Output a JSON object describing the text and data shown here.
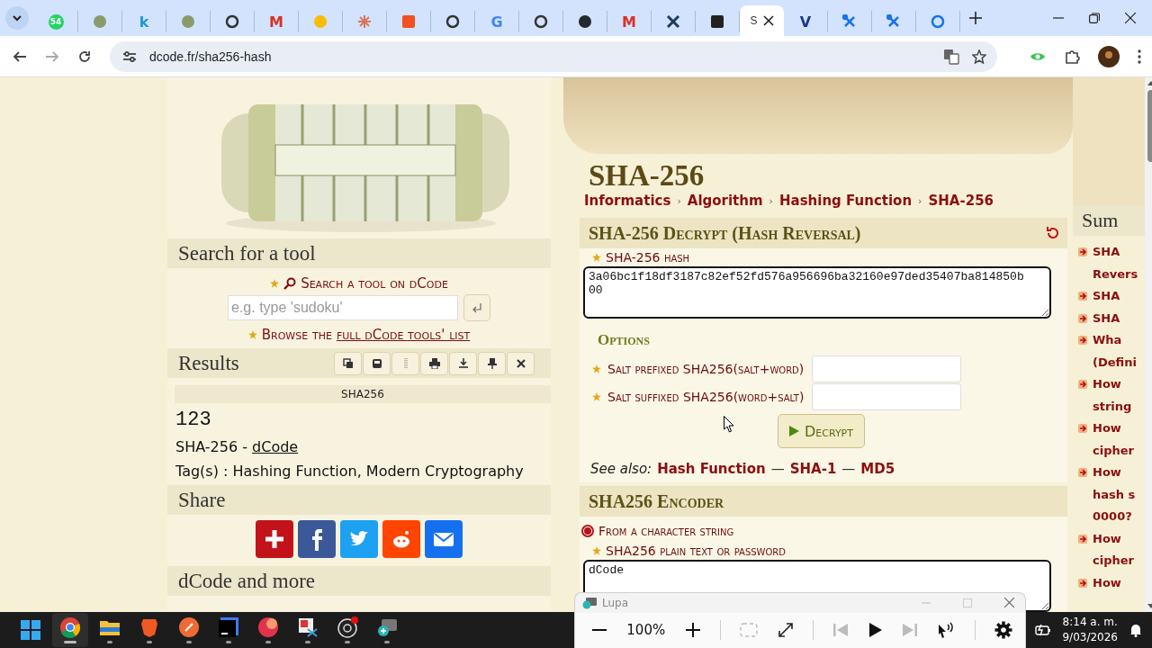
{
  "browser": {
    "tabs": [
      {
        "kind": "badge",
        "badge": "54",
        "color": "#25d366",
        "selected": false
      },
      {
        "kind": "dot",
        "color": "#8a9a6a",
        "selected": false
      },
      {
        "kind": "glyph",
        "glyph": "k",
        "color": "#1a9bd7",
        "selected": false
      },
      {
        "kind": "dot",
        "color": "#8a9a6b",
        "selected": false
      },
      {
        "kind": "ring",
        "color": "#333333",
        "selected": false
      },
      {
        "kind": "glyph",
        "glyph": "M",
        "color": "#d93025",
        "selected": false
      },
      {
        "kind": "dot",
        "color": "#fbbc04",
        "selected": false
      },
      {
        "kind": "star",
        "color": "#d97757",
        "selected": false
      },
      {
        "kind": "square",
        "color": "#f25022",
        "selected": false
      },
      {
        "kind": "ring",
        "color": "#343434",
        "selected": false
      },
      {
        "kind": "glyph",
        "glyph": "G",
        "color": "#4285f4",
        "selected": false
      },
      {
        "kind": "ring",
        "color": "#353535",
        "selected": false
      },
      {
        "kind": "dot",
        "color": "#24292f",
        "selected": false
      },
      {
        "kind": "glyph",
        "glyph": "M",
        "color": "#d93026",
        "selected": false
      },
      {
        "kind": "cross",
        "color": "#1f3a5f",
        "selected": false
      },
      {
        "kind": "square",
        "color": "#222222",
        "selected": false
      },
      {
        "kind": "title",
        "title": "S",
        "selected": true
      },
      {
        "kind": "glyph",
        "glyph": "V",
        "color": "#1a3a8a",
        "selected": false
      },
      {
        "kind": "tool",
        "color": "#1a73e8",
        "selected": false
      },
      {
        "kind": "tool",
        "color": "#1a74e8",
        "selected": false
      },
      {
        "kind": "ring",
        "color": "#1a73e8",
        "selected": false
      }
    ],
    "url": "dcode.fr/sha256-hash"
  },
  "left": {
    "search_title": "Search for a tool",
    "search_link": "Search a tool on dCode",
    "search": {
      "placeholder": "e.g. type 'sudoku'"
    },
    "browse_prefix": "Browse the",
    "browse_link": "full dCode tools' list",
    "results_title": "Results",
    "result_tools": [
      {
        "kind": "copy"
      },
      {
        "kind": "save"
      },
      {
        "kind": "drag"
      },
      {
        "kind": "print"
      },
      {
        "kind": "download"
      },
      {
        "kind": "pin"
      },
      {
        "kind": "close"
      }
    ],
    "result": {
      "label": "SHA256",
      "value": "123",
      "source": "SHA-256 -",
      "source_link": "dCode",
      "tags": "Tag(s) : Hashing Function, Modern Cryptography"
    },
    "share_title": "Share",
    "share": [
      {
        "kind": "plus",
        "color": "#c4121a"
      },
      {
        "kind": "facebook",
        "color": "#3b5998"
      },
      {
        "kind": "twitter",
        "color": "#1da1f2"
      },
      {
        "kind": "reddit",
        "color": "#ff4500"
      },
      {
        "kind": "email",
        "color": "#1570ef"
      }
    ],
    "more_title": "dCode and more"
  },
  "main": {
    "title": "SHA-256",
    "crumb_separator": "›",
    "breadcrumbs": [
      "Informatics",
      "Algorithm",
      "Hashing Function",
      "SHA-256"
    ],
    "decrypt": {
      "title": "SHA-256 Decrypt (Hash Reversal)",
      "hash_label": "SHA-256 hash",
      "hash_value": "3a06bc1f18df3187c82ef52fd576a956696ba32160e97ded35407ba814850b00",
      "options_title": "Options",
      "options": [
        {
          "label": "Salt prefixed SHA256(salt+word)"
        },
        {
          "label": "Salt suffixed SHA256(word+salt)"
        }
      ],
      "button": "Decrypt",
      "see_also_label": "See also:",
      "separator": "—",
      "see_also": [
        "Hash Function",
        "SHA-1",
        "MD5"
      ]
    },
    "encoder": {
      "title": "SHA256 Encoder",
      "modes": [
        {
          "label": "From a character string",
          "selected": true
        }
      ],
      "text_label": "SHA256 plain text or password",
      "text_value": "dCode"
    }
  },
  "side": {
    "title": "Sum",
    "items": [
      {
        "text": "SHA\nRevers"
      },
      {
        "text": "SHA"
      },
      {
        "text": "SHA"
      },
      {
        "text": "Wha\n(Defini"
      },
      {
        "text": "How\nstring"
      },
      {
        "text": "How\ncipher"
      },
      {
        "text": "How\nhash s\n0000?"
      },
      {
        "text": "How\ncipher"
      },
      {
        "text": "How"
      }
    ]
  },
  "taskbar": {
    "apps": [
      {
        "kind": "start",
        "selected": false
      },
      {
        "kind": "chrome",
        "selected": true
      },
      {
        "kind": "folder",
        "selected": false
      },
      {
        "kind": "brave",
        "selected": false
      },
      {
        "kind": "postman",
        "selected": false
      },
      {
        "kind": "ide",
        "selected": false
      },
      {
        "kind": "pdf",
        "selected": false
      },
      {
        "kind": "snip",
        "selected": false
      },
      {
        "kind": "obs",
        "selected": false
      },
      {
        "kind": "magnifier",
        "selected": false
      }
    ],
    "time": "8:14 a. m.",
    "date": "9/03/2026"
  },
  "lupa": {
    "title": "Lupa",
    "zoom": "100%"
  }
}
